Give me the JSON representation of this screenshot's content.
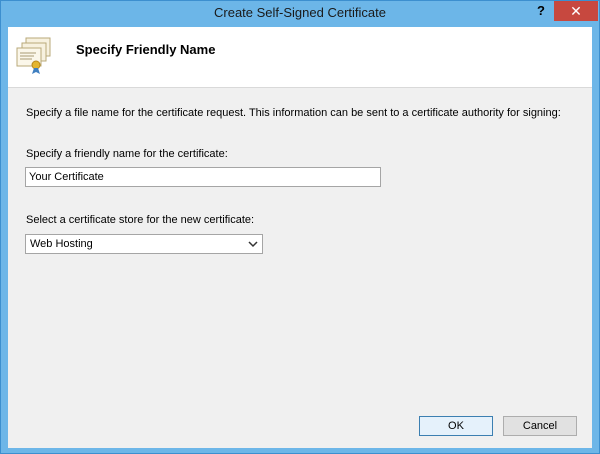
{
  "window": {
    "title": "Create Self-Signed Certificate",
    "help_label": "?",
    "close_label": "✕"
  },
  "header": {
    "title": "Specify Friendly Name",
    "icon": "certificate-icon"
  },
  "content": {
    "description": "Specify a file name for the certificate request.  This information can be sent to a certificate authority for signing:",
    "friendly_label": "Specify a friendly name for the certificate:",
    "friendly_value": "Your Certificate",
    "store_label": "Select a certificate store for the new certificate:",
    "store_value": "Web Hosting"
  },
  "buttons": {
    "ok": "OK",
    "cancel": "Cancel"
  },
  "colors": {
    "titlebar": "#6cb6e8",
    "close": "#c7483f"
  }
}
